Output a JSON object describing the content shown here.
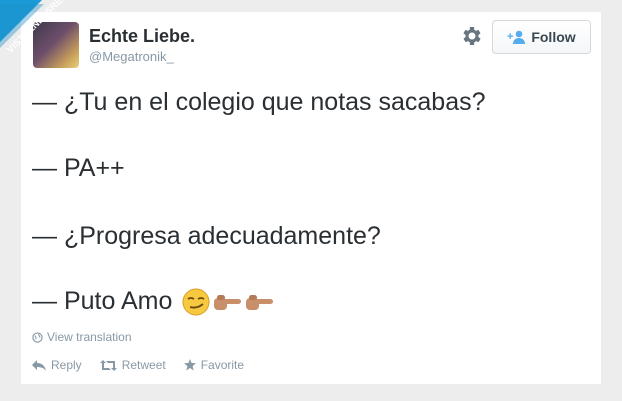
{
  "badge": {
    "text": "VISTOENLASREDES",
    "color": "#1a9bd7"
  },
  "user": {
    "name": "Echte Liebe.",
    "handle": "@Megatronik_"
  },
  "follow_button": {
    "label": "Follow",
    "accent": "#55acee"
  },
  "tweet": {
    "lines": [
      "— ¿Tu en el colegio que notas sacabas?",
      "— PA++",
      "— ¿Progresa adecuadamente?",
      "— Puto Amo"
    ],
    "emojis": [
      "smirking-face-emoji",
      "pointing-right-emoji",
      "pointing-right-emoji"
    ]
  },
  "translation_link": "View translation",
  "actions": {
    "reply": "Reply",
    "retweet": "Retweet",
    "favorite": "Favorite"
  }
}
